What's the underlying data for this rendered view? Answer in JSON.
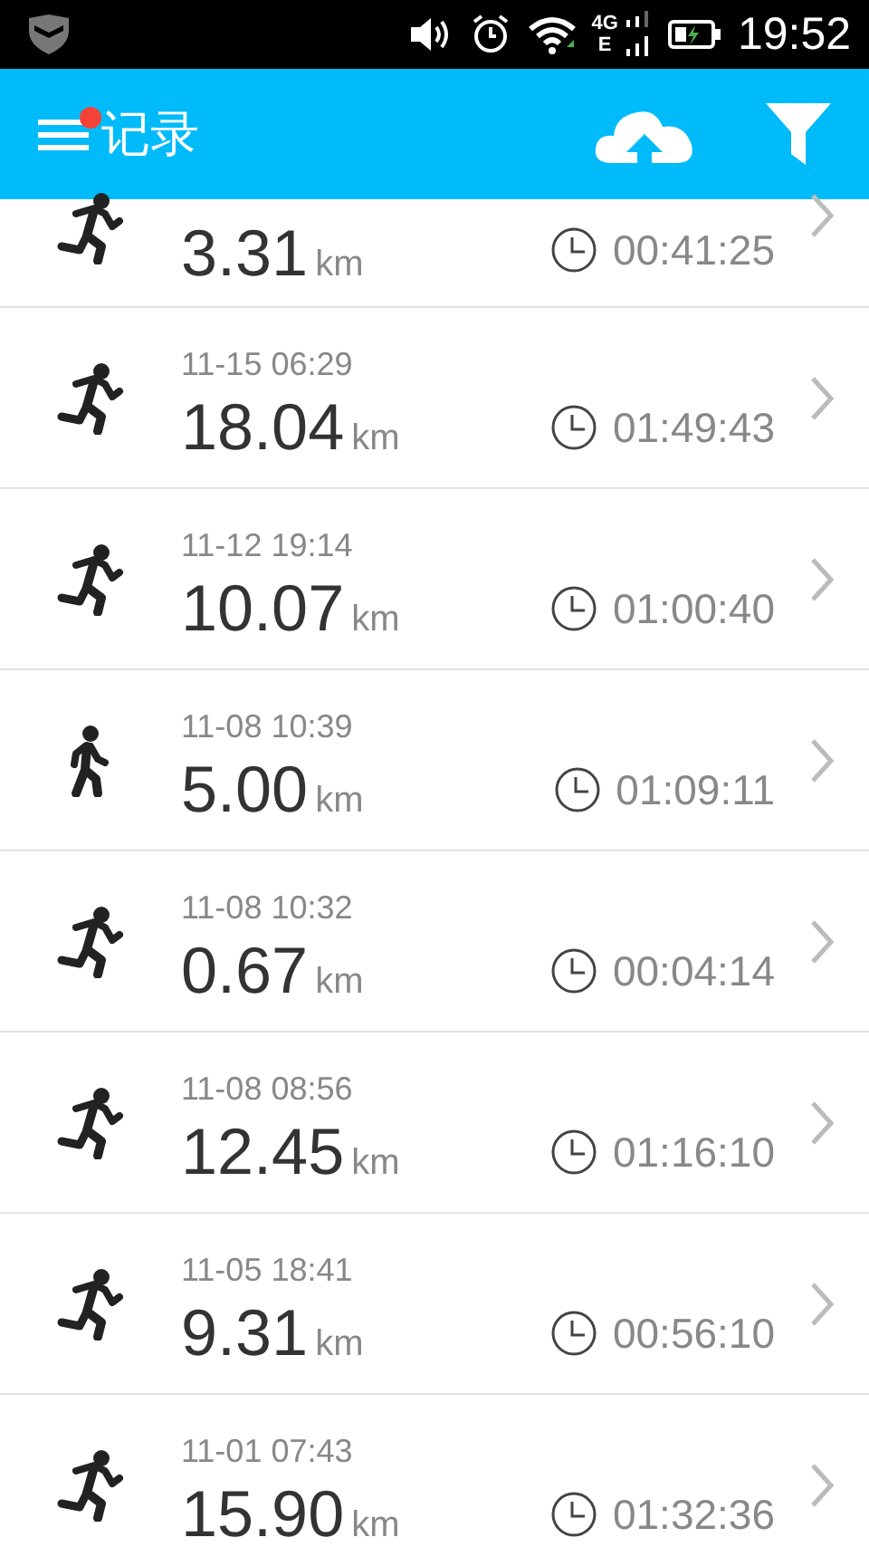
{
  "status_bar": {
    "network_top": "4G",
    "network_bottom": "E",
    "time": "19:52"
  },
  "app_bar": {
    "title": "记录",
    "menu_badge": true
  },
  "records": [
    {
      "kind": "run",
      "distance": "3.31",
      "unit": "km",
      "duration": "00:41:25",
      "partial": true
    },
    {
      "kind": "run",
      "date": "11-15 06:29",
      "distance": "18.04",
      "unit": "km",
      "duration": "01:49:43"
    },
    {
      "kind": "run",
      "date": "11-12 19:14",
      "distance": "10.07",
      "unit": "km",
      "duration": "01:00:40"
    },
    {
      "kind": "walk",
      "date": "11-08 10:39",
      "distance": "5.00",
      "unit": "km",
      "duration": "01:09:11"
    },
    {
      "kind": "run",
      "date": "11-08 10:32",
      "distance": "0.67",
      "unit": "km",
      "duration": "00:04:14"
    },
    {
      "kind": "run",
      "date": "11-08 08:56",
      "distance": "12.45",
      "unit": "km",
      "duration": "01:16:10"
    },
    {
      "kind": "run",
      "date": "11-05 18:41",
      "distance": "9.31",
      "unit": "km",
      "duration": "00:56:10"
    },
    {
      "kind": "run",
      "date": "11-01 07:43",
      "distance": "15.90",
      "unit": "km",
      "duration": "01:32:36"
    }
  ]
}
